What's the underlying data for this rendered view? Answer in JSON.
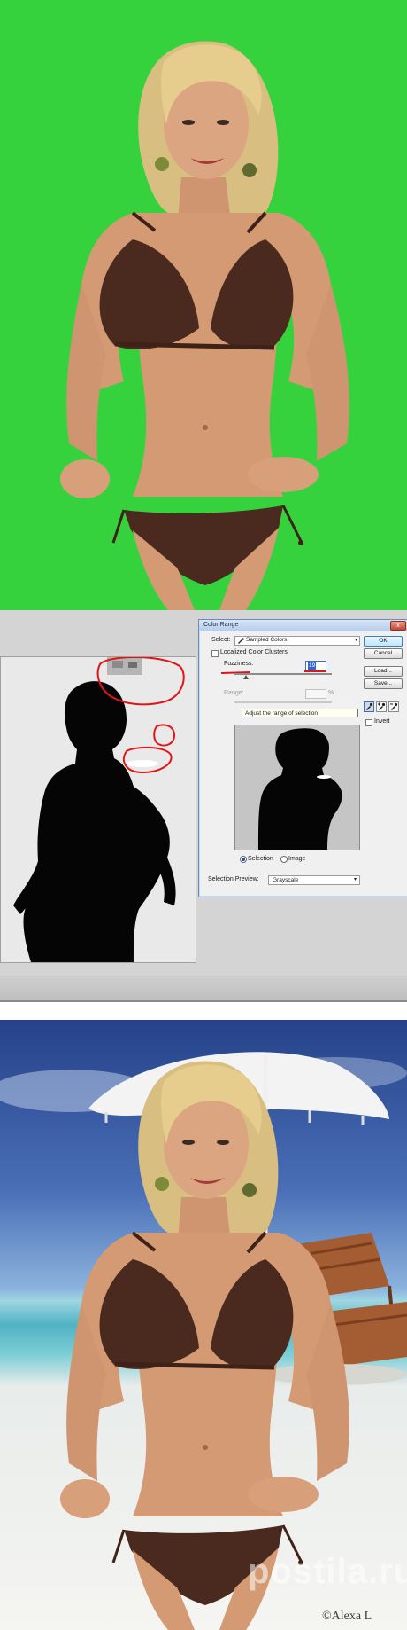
{
  "panels": {
    "green_screen": {
      "name": "green-screen-photo"
    },
    "photoshop": {
      "dialog": {
        "title": "Color Range",
        "close_label": "x",
        "select_label": "Select:",
        "select_value": "Sampled Colors",
        "localized_label": "Localized Color Clusters",
        "fuzziness_label": "Fuzziness:",
        "fuzziness_value": "19",
        "range_label": "Range:",
        "range_pct": "%",
        "tooltip": "Adjust the range of selection",
        "radio_selection": "Selection",
        "radio_image": "Image",
        "preview_label": "Selection Preview:",
        "preview_value": "Grayscale",
        "buttons": {
          "ok": "OK",
          "cancel": "Cancel",
          "load": "Load...",
          "save": "Save..."
        },
        "invert_label": "Invert",
        "dropdown_arrow": "▾"
      }
    },
    "beach": {
      "credit": "©Alexa L"
    }
  },
  "watermark": "postila.ru",
  "colors": {
    "chroma_green": "#35d23d",
    "bikini_brown": "#4a2a1e",
    "skin": "#d9a07a",
    "hair": "#e2c98a",
    "annotation_red": "#e01616"
  }
}
